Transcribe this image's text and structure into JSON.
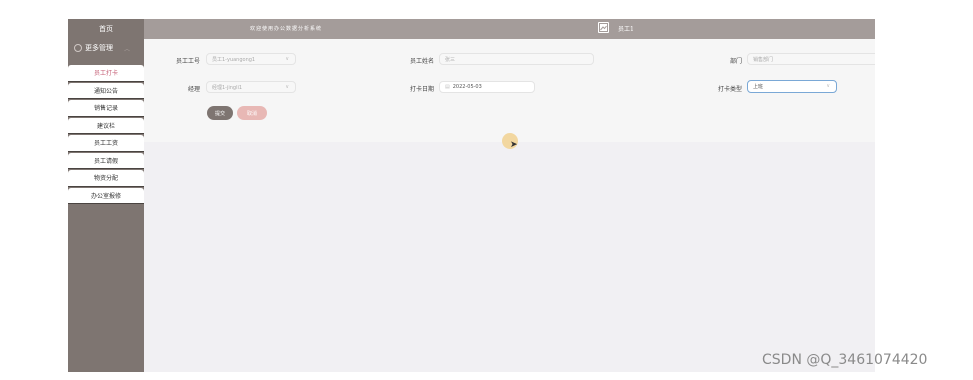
{
  "header": {
    "home_label": "首页",
    "welcome": "欢迎使用办公数据分析系统",
    "username": "员工1"
  },
  "sidebar": {
    "section_title": "更多管理",
    "items": [
      {
        "label": "员工打卡",
        "active": true
      },
      {
        "label": "通知公告"
      },
      {
        "label": "销售记录"
      },
      {
        "label": "建议栏"
      },
      {
        "label": "员工工资"
      },
      {
        "label": "员工请假"
      },
      {
        "label": "物资分配"
      },
      {
        "label": "办公室报修"
      }
    ]
  },
  "form": {
    "employee_no": {
      "label": "员工工号",
      "value": "员工1-yuangong1"
    },
    "employee_name": {
      "label": "员工姓名",
      "value": "张三"
    },
    "department": {
      "label": "部门",
      "value": "销售部门"
    },
    "manager": {
      "label": "经理",
      "value": "经理1-jingli1"
    },
    "punch_date": {
      "label": "打卡日期",
      "value": "2022-05-03"
    },
    "punch_type": {
      "label": "打卡类型",
      "value": "上班"
    },
    "submit_label": "提交",
    "cancel_label": "取消"
  },
  "watermark": "CSDN @Q_3461074420",
  "colors": {
    "sidebar": "#7e7571",
    "topbar": "#a49c9a",
    "active": "#c55f76",
    "cancel": "#e8b8b5"
  }
}
